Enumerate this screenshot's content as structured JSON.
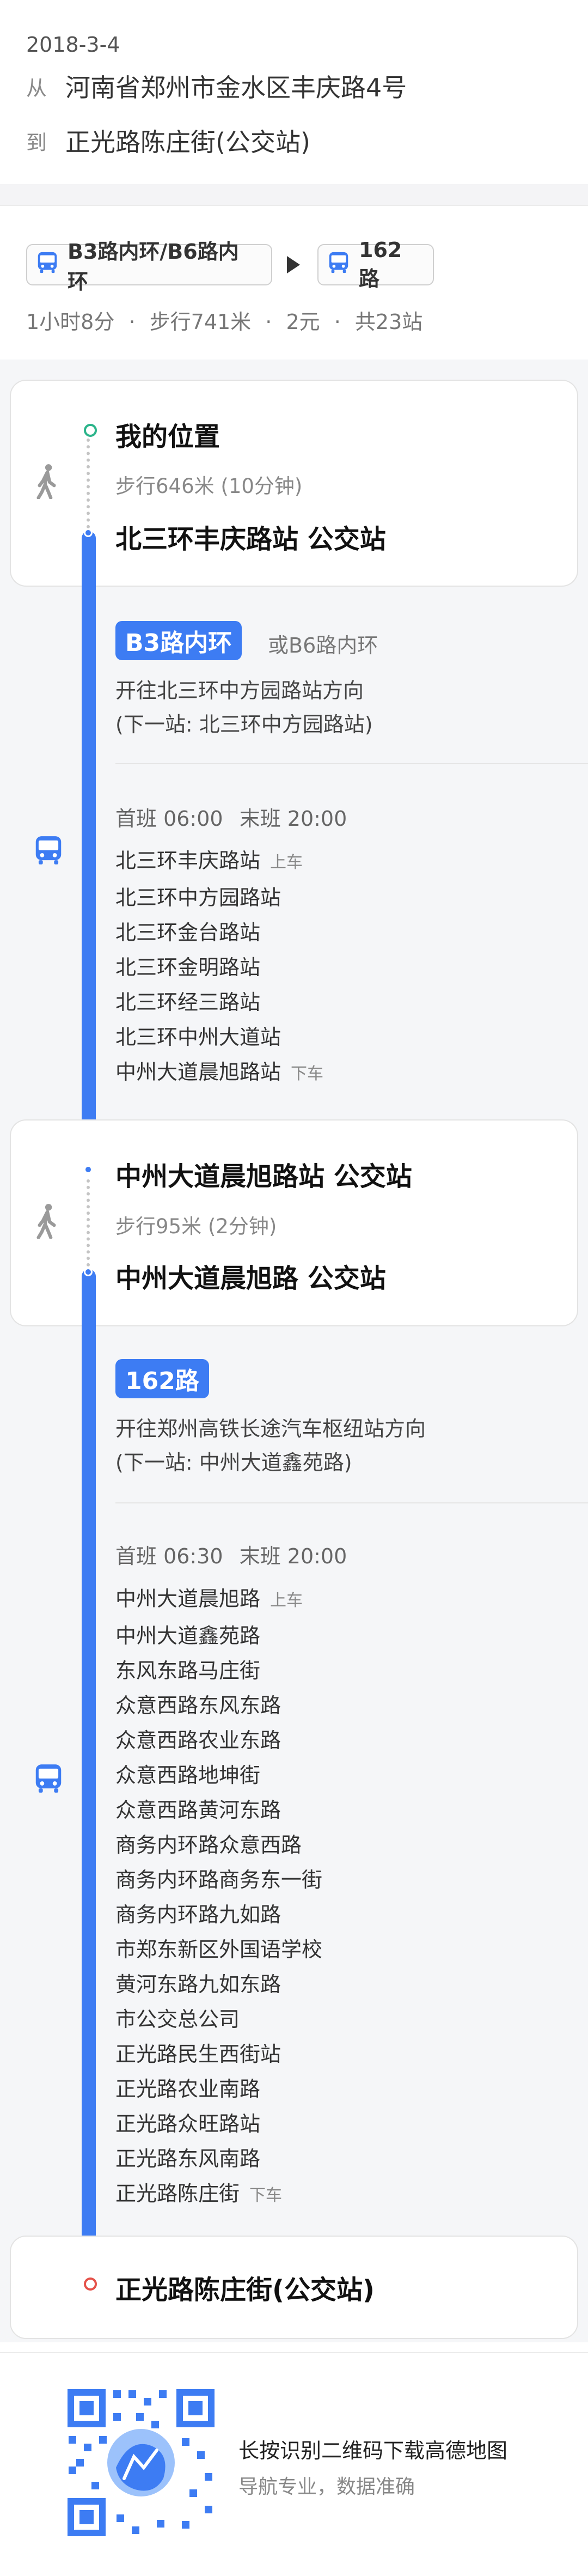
{
  "header": {
    "date": "2018-3-4",
    "from_label": "从",
    "from": "河南省郑州市金水区丰庆路4号",
    "to_label": "到",
    "to": "正光路陈庄街(公交站)"
  },
  "route_summary": {
    "line1": "B3路内环/B6路内环",
    "line2": "162路",
    "duration": "1小时8分",
    "walk": "步行741米",
    "price": "2元",
    "stops": "共23站",
    "separator": "·"
  },
  "start": {
    "title": "我的位置",
    "walk": "步行646米 (10分钟)",
    "board_station": "北三环丰庆路站 公交站"
  },
  "leg1": {
    "line": "B3路内环",
    "alt": "或B6路内环",
    "direction": "开往北三环中方园路站方向",
    "next": "(下一站: 北三环中方园路站)",
    "first_label": "首班 06:00",
    "last_label": "末班 20:00",
    "stops": [
      {
        "name": "北三环丰庆路站",
        "tag": "上车"
      },
      {
        "name": "北三环中方园路站",
        "tag": ""
      },
      {
        "name": "北三环金台路站",
        "tag": ""
      },
      {
        "name": "北三环金明路站",
        "tag": ""
      },
      {
        "name": "北三环经三路站",
        "tag": ""
      },
      {
        "name": "北三环中州大道站",
        "tag": ""
      },
      {
        "name": "中州大道晨旭路站",
        "tag": "下车"
      }
    ]
  },
  "transfer": {
    "alight_station": "中州大道晨旭路站 公交站",
    "walk": "步行95米 (2分钟)",
    "board_station": "中州大道晨旭路 公交站"
  },
  "leg2": {
    "line": "162路",
    "direction": "开往郑州高铁长途汽车枢纽站方向",
    "next": "(下一站: 中州大道鑫苑路)",
    "first_label": "首班 06:30",
    "last_label": "末班 20:00",
    "stops": [
      {
        "name": "中州大道晨旭路",
        "tag": "上车"
      },
      {
        "name": "中州大道鑫苑路",
        "tag": ""
      },
      {
        "name": "东风东路马庄街",
        "tag": ""
      },
      {
        "name": "众意西路东风东路",
        "tag": ""
      },
      {
        "name": "众意西路农业东路",
        "tag": ""
      },
      {
        "name": "众意西路地坤街",
        "tag": ""
      },
      {
        "name": "众意西路黄河东路",
        "tag": ""
      },
      {
        "name": "商务内环路众意西路",
        "tag": ""
      },
      {
        "name": "商务内环路商务东一街",
        "tag": ""
      },
      {
        "name": "商务内环路九如路",
        "tag": ""
      },
      {
        "name": "市郑东新区外国语学校",
        "tag": ""
      },
      {
        "name": "黄河东路九如东路",
        "tag": ""
      },
      {
        "name": "市公交总公司",
        "tag": ""
      },
      {
        "name": "正光路民生西街站",
        "tag": ""
      },
      {
        "name": "正光路农业南路",
        "tag": ""
      },
      {
        "name": "正光路众旺路站",
        "tag": ""
      },
      {
        "name": "正光路东风南路",
        "tag": ""
      },
      {
        "name": "正光路陈庄街",
        "tag": "下车"
      }
    ]
  },
  "end": {
    "title": "正光路陈庄街(公交站)"
  },
  "footer": {
    "qr_line1": "长按识别二维码下载高德地图",
    "qr_line2": "导航专业，数据准确"
  },
  "colors": {
    "accent": "#3d7cf3",
    "start_dot": "#2bb48a",
    "end_dot": "#e5524a"
  },
  "icons": [
    "bus-icon",
    "walk-icon",
    "qr-code"
  ]
}
